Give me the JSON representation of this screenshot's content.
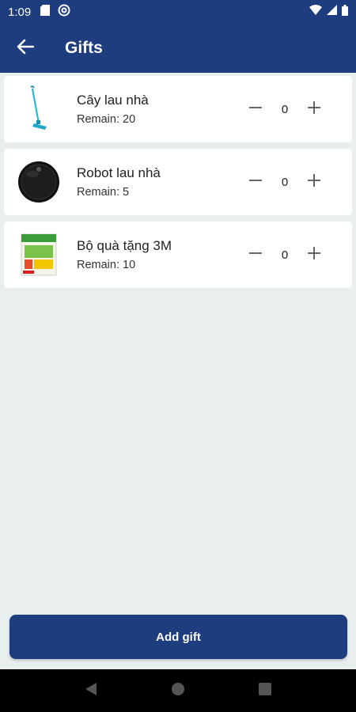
{
  "status_bar": {
    "time": "1:09",
    "icons": [
      "sd-card-icon",
      "at-sign-icon",
      "wifi-icon",
      "signal-icon",
      "battery-icon"
    ]
  },
  "app_bar": {
    "back_icon": "arrow-left-icon",
    "title": "Gifts"
  },
  "gifts": [
    {
      "name": "Cây lau nhà",
      "remain_label": "Remain:",
      "remain": "20",
      "quantity": "0",
      "image": "mop-icon"
    },
    {
      "name": "Robot lau nhà",
      "remain_label": "Remain:",
      "remain": "5",
      "quantity": "0",
      "image": "robot-vacuum-icon"
    },
    {
      "name": "Bộ quà tặng 3M",
      "remain_label": "Remain:",
      "remain": "10",
      "quantity": "0",
      "image": "gift-box-icon"
    }
  ],
  "add_button": {
    "label": "Add gift"
  },
  "colors": {
    "primary": "#1e3d7e",
    "background": "#e9eeef",
    "card": "#ffffff"
  }
}
